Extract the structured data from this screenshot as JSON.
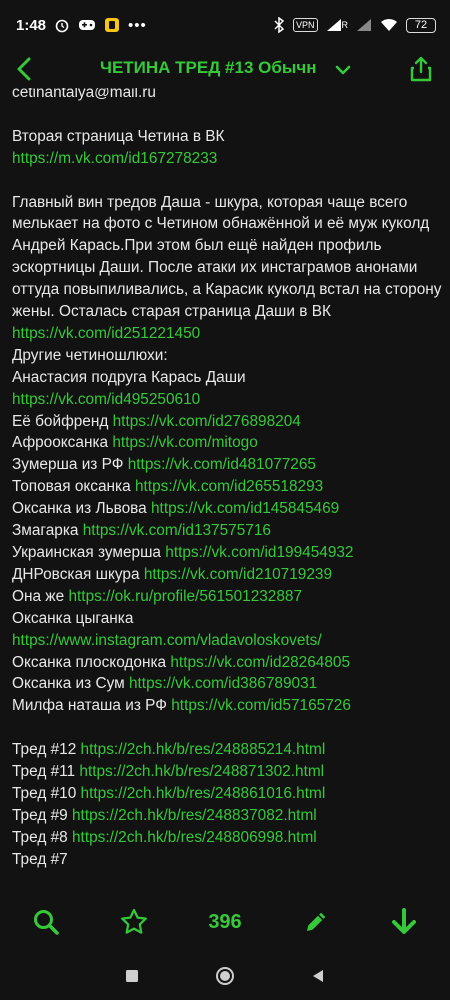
{
  "status_bar": {
    "time": "1:48",
    "vpn": "VPN",
    "signal_label": "R",
    "battery": "72"
  },
  "toolbar": {
    "title": "ЧЕТИНА ТРЕД #13 Обычн",
    "icons": [
      "back-arrow-icon",
      "chevron-down-icon",
      "share-icon"
    ]
  },
  "post": {
    "email_line": "cetinantalya@mail.ru",
    "vk2_label": "Вторая страница Четина в ВК",
    "vk2_url": "https://m.vk.com/id167278233",
    "main_paragraph": "Главный вин тредов Даша - шкура, которая чаще всего мелькает на фото с Четином обнажённой и её муж куколд Андрей Карась.При этом был ещё найден профиль эскортницы Даши. После атаки их инстаграмов анонами оттуда повыпиливались, а Карасик куколд встал на сторону жены. Осталась старая страница Даши в ВК",
    "dasha_url": "https://vk.com/id251221450",
    "others_heading": "Другие четиношлюхи:",
    "anastasia_label": "Анастасия подруга Карась Даши",
    "anastasia_url": "https://vk.com/id495250610",
    "entries": [
      {
        "label": "Её бойфренд",
        "url": "https://vk.com/id276898204"
      },
      {
        "label": "Афрооксанка",
        "url": "https://vk.com/mitogo"
      },
      {
        "label": "Зумерша из РФ",
        "url": "https://vk.com/id481077265"
      },
      {
        "label": "Топовая оксанка",
        "url": "https://vk.com/id265518293"
      },
      {
        "label": "Оксанка из Львова",
        "url": "https://vk.com/id145845469"
      },
      {
        "label": "Змагарка",
        "url": "https://vk.com/id137575716"
      },
      {
        "label": "Украинская зумерша",
        "url": "https://vk.com/id199454932"
      },
      {
        "label": "ДНРовская шкура",
        "url": "https://vk.com/id210719239"
      },
      {
        "label": "Она же",
        "url": "https://ok.ru/profile/561501232887"
      }
    ],
    "gypsy_label": "Оксанка цыганка",
    "gypsy_url": "https://www.instagram.com/vladavoloskovets/",
    "entries2": [
      {
        "label": "Оксанка плоскодонка",
        "url": "https://vk.com/id28264805"
      },
      {
        "label": "Оксанка из Сум",
        "url": "https://vk.com/id386789031"
      },
      {
        "label": "Милфа наташа из РФ",
        "url": "https://vk.com/id57165726"
      }
    ],
    "threads": [
      {
        "label": "Тред #12",
        "url": "https://2ch.hk/b/res/248885214.html"
      },
      {
        "label": "Тред #11",
        "url": "https://2ch.hk/b/res/248871302.html"
      },
      {
        "label": "Тред #10",
        "url": "https://2ch.hk/b/res/248861016.html"
      },
      {
        "label": "Тред #9",
        "url": "https://2ch.hk/b/res/248837082.html"
      },
      {
        "label": "Тред #8",
        "url": "https://2ch.hk/b/res/248806998.html"
      }
    ],
    "last_thread_label": "Тред #7"
  },
  "bottom_bar": {
    "post_count": "396",
    "icons": [
      "search-icon",
      "star-icon",
      "pencil-icon",
      "arrow-down-icon"
    ]
  },
  "colors": {
    "accent": "#35c93a",
    "background": "#121212",
    "text": "#e8e8e8"
  }
}
